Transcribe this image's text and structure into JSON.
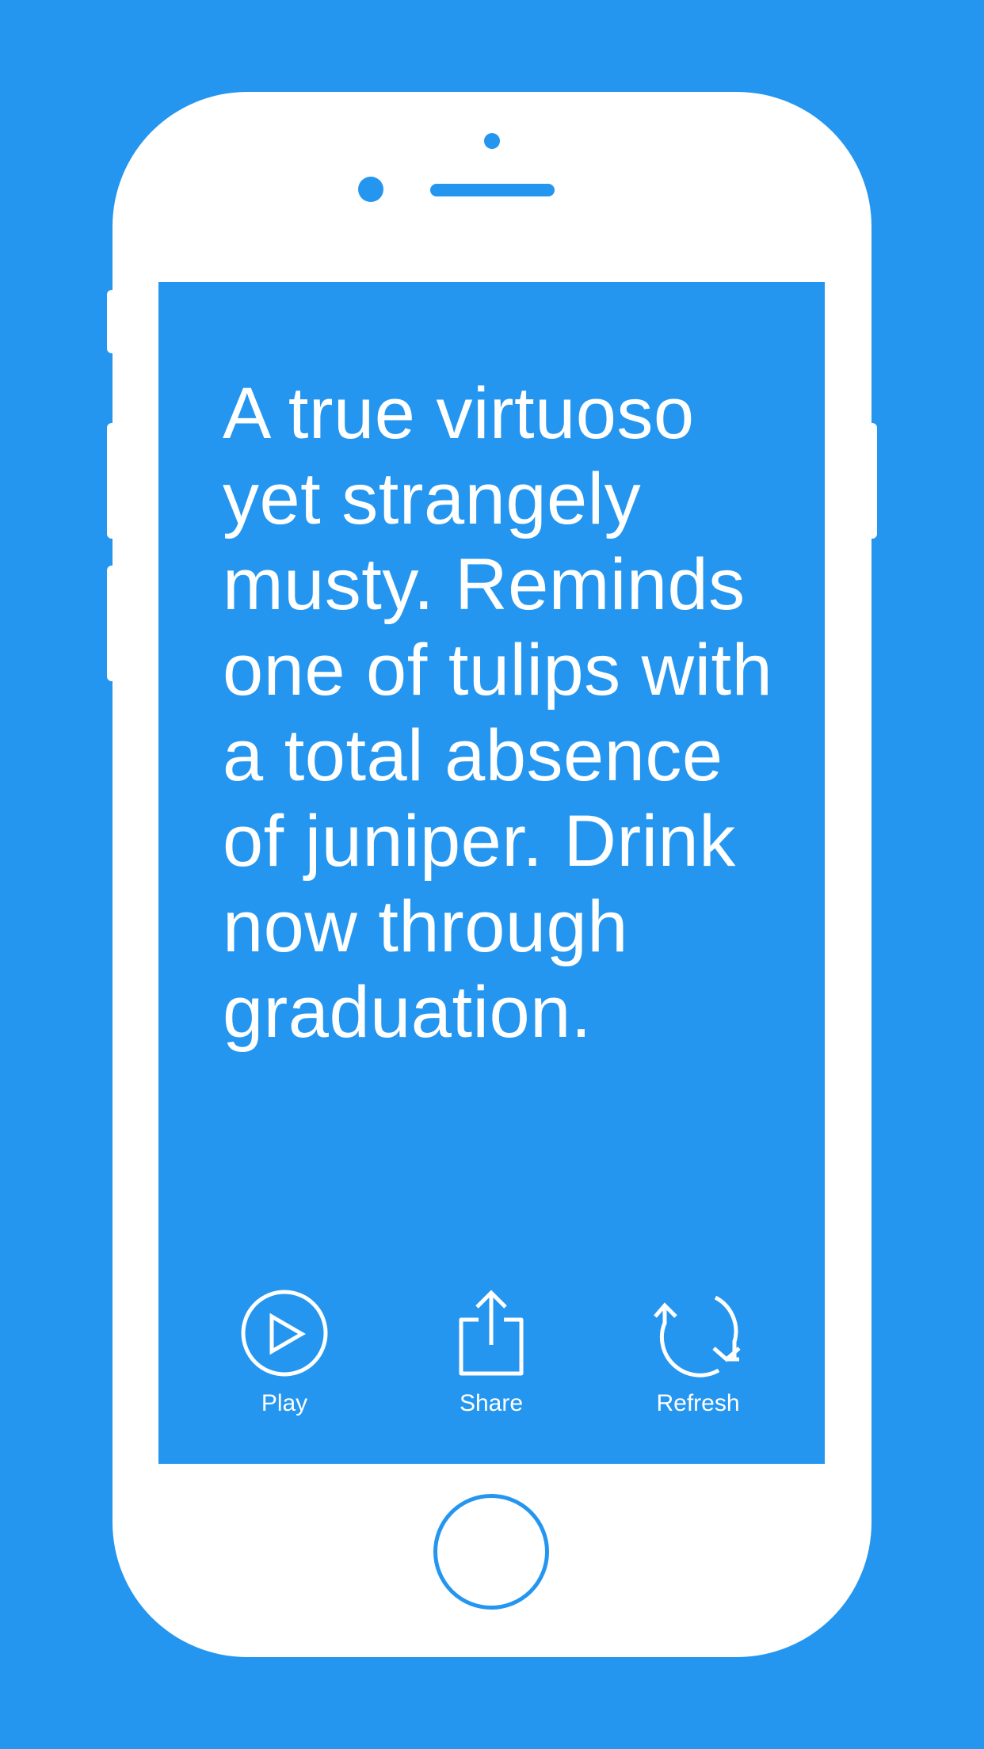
{
  "colors": {
    "background": "#2496f0",
    "device": "#ffffff",
    "text": "#ffffff"
  },
  "quote": {
    "text": "A true virtuoso yet strangely musty. Reminds one of tulips with a total absence of juniper. Drink now through graduation."
  },
  "actions": [
    {
      "label": "Play",
      "icon": "play-icon"
    },
    {
      "label": "Share",
      "icon": "share-icon"
    },
    {
      "label": "Refresh",
      "icon": "refresh-icon"
    }
  ]
}
